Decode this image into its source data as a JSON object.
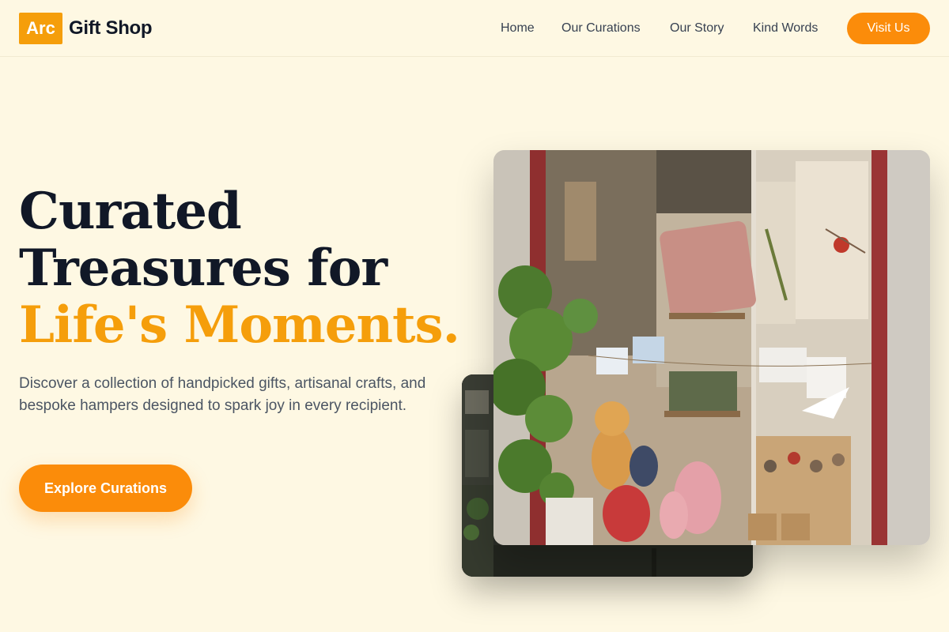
{
  "header": {
    "logo_badge": "Arc",
    "logo_text": "Gift Shop",
    "nav": [
      {
        "label": "Home"
      },
      {
        "label": "Our Curations"
      },
      {
        "label": "Our Story"
      },
      {
        "label": "Kind Words"
      }
    ],
    "cta_label": "Visit Us"
  },
  "hero": {
    "title_line1": "Curated",
    "title_line2": "Treasures for",
    "title_accent": "Life's Moments.",
    "subtitle": "Discover a collection of handpicked gifts, artisanal crafts, and bespoke hampers designed to spark joy in every recipient.",
    "button_label": "Explore Curations"
  },
  "colors": {
    "background": "#fef8e3",
    "accent": "#f59e0b",
    "button": "#fb8c0a",
    "heading": "#111827"
  },
  "images": {
    "main": "gift-shop-window-photo",
    "secondary": "shop-interior-photo"
  }
}
